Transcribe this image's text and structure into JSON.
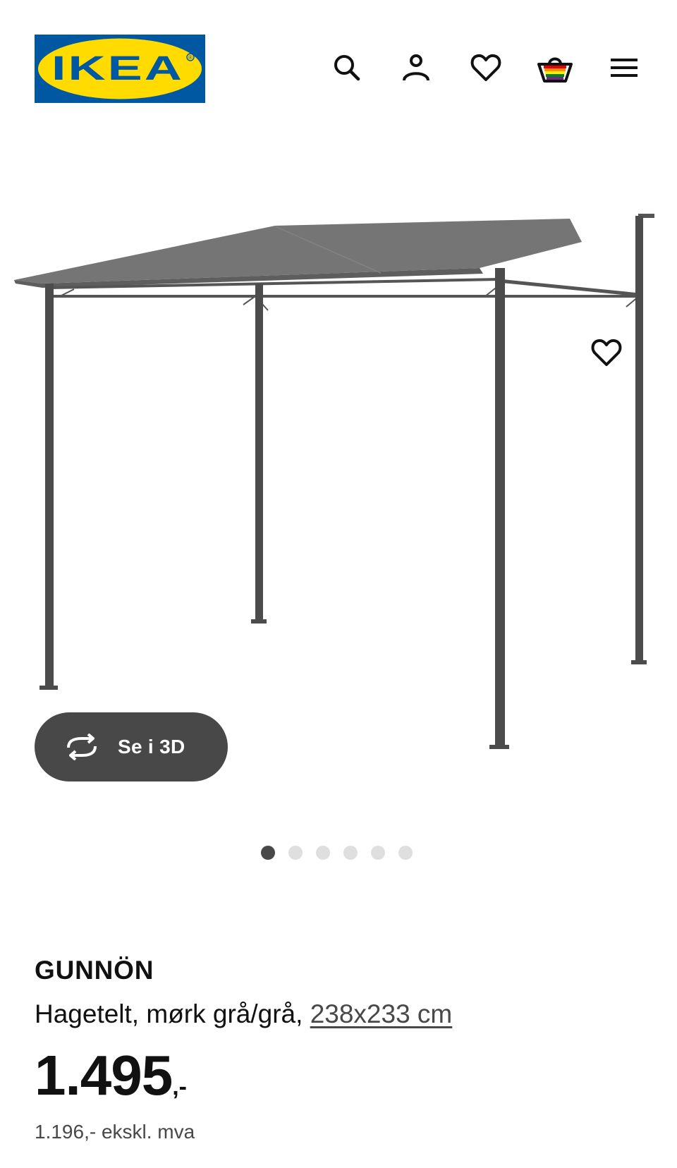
{
  "header": {
    "logo_text": "IKEA",
    "logo_registered": "®",
    "icons": [
      "search-icon",
      "account-icon",
      "heart-icon",
      "shopping-bag-icon",
      "hamburger-menu-icon"
    ],
    "colors": {
      "logo_blue": "#0058a3",
      "logo_yellow": "#ffdb00"
    }
  },
  "gallery": {
    "view_3d_label": "Se i 3D",
    "slide_count": 6,
    "active_slide": 1
  },
  "product": {
    "name": "GUNNÖN",
    "description": "Hagetelt, mørk grå/grå,",
    "size_link": "238x233 cm",
    "price": "1.495",
    "price_suffix": ",-",
    "price_ex_vat": "1.196,- ekskl. mva"
  },
  "colors": {
    "text": "#111111",
    "secondary_text": "#484848",
    "button_dark": "#484848",
    "dot_inactive": "#dfdfdf"
  }
}
